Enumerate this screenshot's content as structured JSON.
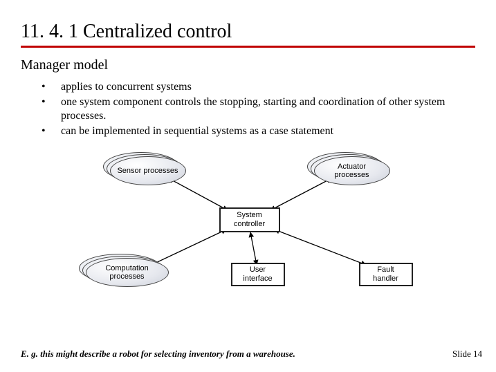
{
  "title": "11. 4. 1 Centralized control",
  "subtitle": "Manager model",
  "bullets": [
    "applies to concurrent systems",
    "one system component controls the stopping, starting and coordination of other system processes.",
    "can be implemented in sequential systems as a case statement"
  ],
  "diagram": {
    "nodes": {
      "sensor": "Sensor processes",
      "actuator": "Actuator processes",
      "controller": "System controller",
      "computation": "Computation processes",
      "ui": "User interface",
      "fault": "Fault handler"
    }
  },
  "footer": "E. g. this might describe a robot for selecting inventory from a warehouse.",
  "slide_number": "Slide 14"
}
